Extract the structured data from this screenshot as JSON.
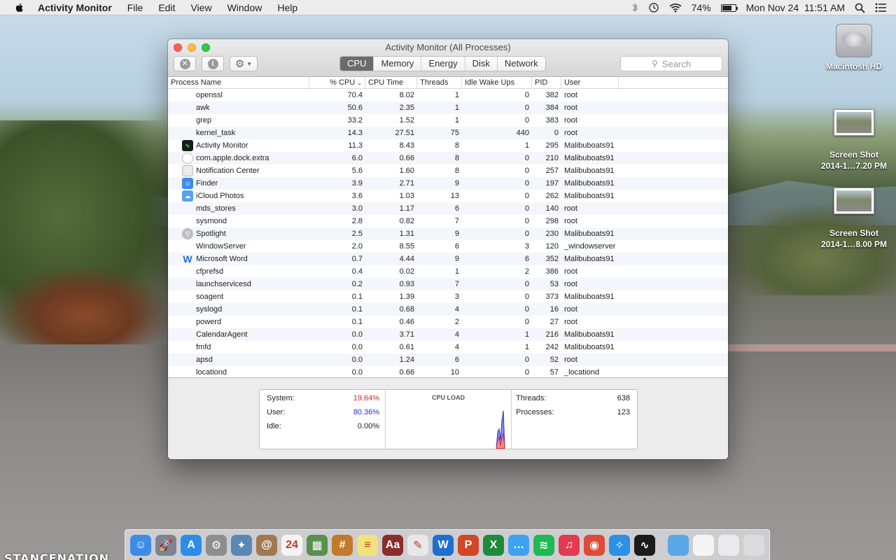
{
  "menubar": {
    "app_name": "Activity Monitor",
    "menus": [
      "File",
      "Edit",
      "View",
      "Window",
      "Help"
    ],
    "battery_pct": "74%",
    "battery_level": 0.74,
    "datetime": "Mon Nov 24  11:51 AM"
  },
  "desktop": {
    "icons": [
      {
        "label": "Macintosh HD",
        "kind": "hard-drive"
      },
      {
        "label": "Screen Shot\n2014-1…7.20 PM",
        "line1": "Screen Shot",
        "line2": "2014-1…7.20 PM",
        "kind": "screenshot"
      },
      {
        "label": "Screen Shot\n2014-1…8.00 PM",
        "line1": "Screen Shot",
        "line2": "2014-1…8.00 PM",
        "kind": "screenshot"
      }
    ],
    "watermark": "STANCENATION"
  },
  "window": {
    "title": "Activity Monitor (All Processes)",
    "tabs": [
      "CPU",
      "Memory",
      "Energy",
      "Disk",
      "Network"
    ],
    "active_tab": "CPU",
    "search_placeholder": "Search",
    "columns": [
      "Process Name",
      "% CPU",
      "CPU Time",
      "Threads",
      "Idle Wake Ups",
      "PID",
      "User"
    ],
    "sort_column": "% CPU",
    "processes": [
      {
        "name": "openssl",
        "cpu": "70.4",
        "time": "8.02",
        "threads": "1",
        "wake": "0",
        "pid": "382",
        "user": "root",
        "icon": ""
      },
      {
        "name": "awk",
        "cpu": "50.6",
        "time": "2.35",
        "threads": "1",
        "wake": "0",
        "pid": "384",
        "user": "root",
        "icon": ""
      },
      {
        "name": "grep",
        "cpu": "33.2",
        "time": "1.52",
        "threads": "1",
        "wake": "0",
        "pid": "383",
        "user": "root",
        "icon": ""
      },
      {
        "name": "kernel_task",
        "cpu": "14.3",
        "time": "27.51",
        "threads": "75",
        "wake": "440",
        "pid": "0",
        "user": "root",
        "icon": ""
      },
      {
        "name": "Activity Monitor",
        "cpu": "11.3",
        "time": "8.43",
        "threads": "8",
        "wake": "1",
        "pid": "295",
        "user": "Malibuboats91",
        "icon": "activity-monitor-icon"
      },
      {
        "name": "com.apple.dock.extra",
        "cpu": "6.0",
        "time": "0.66",
        "threads": "8",
        "wake": "0",
        "pid": "210",
        "user": "Malibuboats91",
        "icon": "shield-icon"
      },
      {
        "name": "Notification Center",
        "cpu": "5.6",
        "time": "1.60",
        "threads": "8",
        "wake": "0",
        "pid": "257",
        "user": "Malibuboats91",
        "icon": "notification-center-icon"
      },
      {
        "name": "Finder",
        "cpu": "3.9",
        "time": "2.71",
        "threads": "9",
        "wake": "0",
        "pid": "197",
        "user": "Malibuboats91",
        "icon": "finder-icon"
      },
      {
        "name": "iCloud Photos",
        "cpu": "3.6",
        "time": "1.03",
        "threads": "13",
        "wake": "0",
        "pid": "262",
        "user": "Malibuboats91",
        "icon": "icloud-icon"
      },
      {
        "name": "mds_stores",
        "cpu": "3.0",
        "time": "1.17",
        "threads": "6",
        "wake": "0",
        "pid": "140",
        "user": "root",
        "icon": ""
      },
      {
        "name": "sysmond",
        "cpu": "2.8",
        "time": "0.82",
        "threads": "7",
        "wake": "0",
        "pid": "298",
        "user": "root",
        "icon": ""
      },
      {
        "name": "Spotlight",
        "cpu": "2.5",
        "time": "1.31",
        "threads": "9",
        "wake": "0",
        "pid": "230",
        "user": "Malibuboats91",
        "icon": "spotlight-icon"
      },
      {
        "name": "WindowServer",
        "cpu": "2.0",
        "time": "8.55",
        "threads": "6",
        "wake": "3",
        "pid": "120",
        "user": "_windowserver",
        "icon": ""
      },
      {
        "name": "Microsoft Word",
        "cpu": "0.7",
        "time": "4.44",
        "threads": "9",
        "wake": "6",
        "pid": "352",
        "user": "Malibuboats91",
        "icon": "word-icon"
      },
      {
        "name": "cfprefsd",
        "cpu": "0.4",
        "time": "0.02",
        "threads": "1",
        "wake": "2",
        "pid": "386",
        "user": "root",
        "icon": ""
      },
      {
        "name": "launchservicesd",
        "cpu": "0.2",
        "time": "0.93",
        "threads": "7",
        "wake": "0",
        "pid": "53",
        "user": "root",
        "icon": ""
      },
      {
        "name": "soagent",
        "cpu": "0.1",
        "time": "1.39",
        "threads": "3",
        "wake": "0",
        "pid": "373",
        "user": "Malibuboats91",
        "icon": ""
      },
      {
        "name": "syslogd",
        "cpu": "0.1",
        "time": "0.68",
        "threads": "4",
        "wake": "0",
        "pid": "16",
        "user": "root",
        "icon": ""
      },
      {
        "name": "powerd",
        "cpu": "0.1",
        "time": "0.46",
        "threads": "2",
        "wake": "0",
        "pid": "27",
        "user": "root",
        "icon": ""
      },
      {
        "name": "CalendarAgent",
        "cpu": "0.0",
        "time": "3.71",
        "threads": "4",
        "wake": "1",
        "pid": "216",
        "user": "Malibuboats91",
        "icon": ""
      },
      {
        "name": "fmfd",
        "cpu": "0.0",
        "time": "0.61",
        "threads": "4",
        "wake": "1",
        "pid": "242",
        "user": "Malibuboats91",
        "icon": ""
      },
      {
        "name": "apsd",
        "cpu": "0.0",
        "time": "1.24",
        "threads": "6",
        "wake": "0",
        "pid": "52",
        "user": "root",
        "icon": ""
      },
      {
        "name": "locationd",
        "cpu": "0.0",
        "time": "0.66",
        "threads": "10",
        "wake": "0",
        "pid": "57",
        "user": "_locationd",
        "icon": ""
      }
    ],
    "summary": {
      "system_label": "System:",
      "system_value": "19.64%",
      "user_label": "User:",
      "user_value": "80.36%",
      "idle_label": "Idle:",
      "idle_value": "0.00%",
      "cpu_load_title": "CPU LOAD",
      "threads_label": "Threads:",
      "threads_value": "638",
      "processes_label": "Processes:",
      "processes_value": "123"
    },
    "colors": {
      "system": "#e0212b",
      "user": "#2b2bd6"
    }
  },
  "dock": {
    "apps": [
      {
        "name": "finder-icon",
        "glyph": "☺",
        "color": "#3d8ce6",
        "running": true
      },
      {
        "name": "launchpad-icon",
        "glyph": "🚀",
        "color": "#7d8490",
        "running": false
      },
      {
        "name": "app-store-icon",
        "glyph": "A",
        "color": "#2a8ee8",
        "running": false
      },
      {
        "name": "system-preferences-icon",
        "glyph": "⚙",
        "color": "#8e8e8e",
        "running": false
      },
      {
        "name": "preview-icon",
        "glyph": "✦",
        "color": "#5b87b3",
        "running": false
      },
      {
        "name": "contacts-icon",
        "glyph": "@",
        "color": "#a07a4e",
        "running": false
      },
      {
        "name": "calendar-icon",
        "glyph": "24",
        "color": "#f4f4f4",
        "running": false
      },
      {
        "name": "photos-icon",
        "glyph": "▦",
        "color": "#5a8f4f",
        "running": false
      },
      {
        "name": "calculator-icon",
        "glyph": "#",
        "color": "#c07a2a",
        "running": false
      },
      {
        "name": "notes-icon",
        "glyph": "≡",
        "color": "#f2e27a",
        "running": false
      },
      {
        "name": "dictionary-icon",
        "glyph": "Aa",
        "color": "#8b2c2c",
        "running": false
      },
      {
        "name": "textedit-icon",
        "glyph": "✎",
        "color": "#e8e8e8",
        "running": false
      },
      {
        "name": "word-icon",
        "glyph": "W",
        "color": "#1f6fd0",
        "running": true
      },
      {
        "name": "powerpoint-icon",
        "glyph": "P",
        "color": "#d24726",
        "running": false
      },
      {
        "name": "excel-icon",
        "glyph": "X",
        "color": "#1e8b3a",
        "running": false
      },
      {
        "name": "messages-icon",
        "glyph": "…",
        "color": "#3ea1f2",
        "running": false
      },
      {
        "name": "spotify-icon",
        "glyph": "≋",
        "color": "#1db954",
        "running": false
      },
      {
        "name": "itunes-icon",
        "glyph": "♫",
        "color": "#e23a4e",
        "running": false
      },
      {
        "name": "chrome-icon",
        "glyph": "◉",
        "color": "#dd4b39",
        "running": false
      },
      {
        "name": "safari-icon",
        "glyph": "✧",
        "color": "#2d8fe6",
        "running": true
      },
      {
        "name": "activity-monitor-icon",
        "glyph": "∿",
        "color": "#1b1b1b",
        "running": true
      },
      {
        "name": "downloads-folder-icon",
        "glyph": "",
        "color": "#5aa7e8",
        "running": false,
        "after_sep": true
      },
      {
        "name": "documents-icon",
        "glyph": "",
        "color": "#f5f5f5",
        "running": false
      },
      {
        "name": "screenshot-stack-icon",
        "glyph": "",
        "color": "#e9e9ee",
        "running": false
      },
      {
        "name": "trash-icon",
        "glyph": "",
        "color": "#dcdcdc",
        "running": false
      }
    ]
  }
}
